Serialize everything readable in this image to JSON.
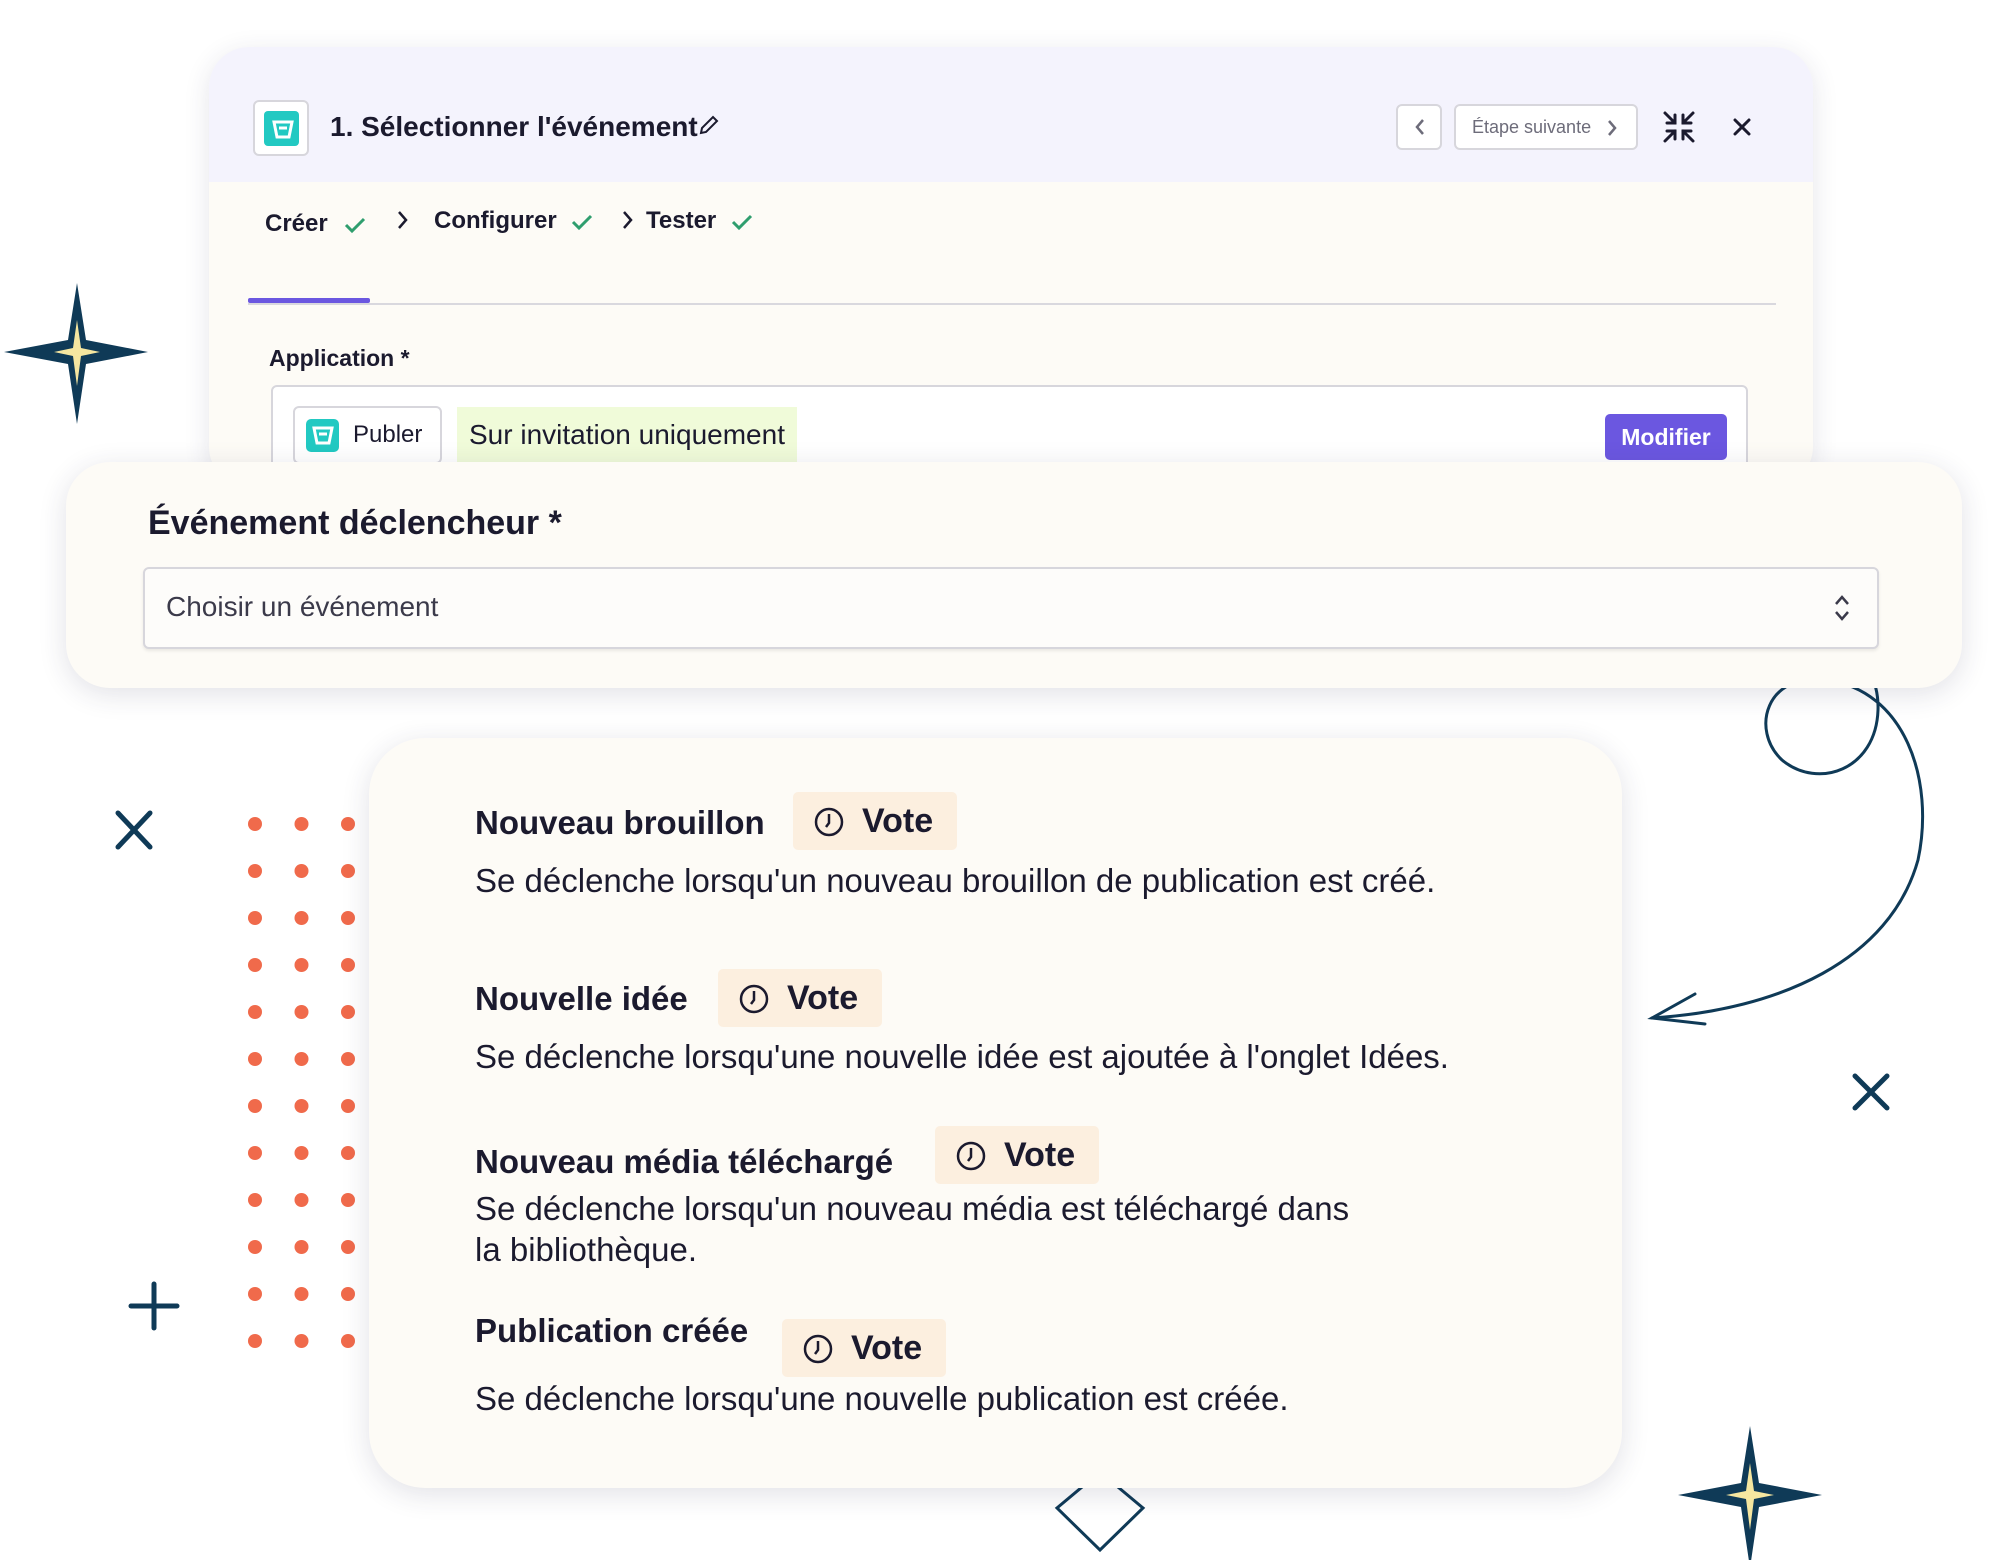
{
  "colors": {
    "accent": "#6b57e0",
    "publer_teal": "#22c9c2",
    "invite_bg": "#f0fbd9",
    "vote_bg": "#fcefdf",
    "dots": "#f06a4b",
    "deco_navy": "#0f3a57",
    "deco_gold": "#f5e6a0"
  },
  "top_panel": {
    "step_title": "1. Sélectionner l'événement",
    "next_step_label": "Étape suivante",
    "tabs": [
      {
        "label": "Créer"
      },
      {
        "label": "Configurer"
      },
      {
        "label": "Tester"
      }
    ],
    "application_label": "Application *",
    "app_name": "Publer",
    "invite_badge": "Sur invitation uniquement",
    "modify_label": "Modifier"
  },
  "trigger": {
    "label": "Événement déclencheur *",
    "select_placeholder": "Choisir un événement"
  },
  "events": [
    {
      "title": "Nouveau brouillon",
      "badge": "Vote",
      "description": "Se déclenche lorsqu'un nouveau brouillon de publication est créé."
    },
    {
      "title": "Nouvelle idée",
      "badge": "Vote",
      "description": "Se déclenche lorsqu'une nouvelle idée est ajoutée à l'onglet Idées."
    },
    {
      "title": "Nouveau média téléchargé",
      "badge": "Vote",
      "description_line1": "Se déclenche lorsqu'un nouveau média est téléchargé dans",
      "description_line2": "la bibliothèque."
    },
    {
      "title": "Publication créée",
      "badge": "Vote",
      "description": "Se déclenche lorsqu'une nouvelle publication est créée."
    }
  ]
}
